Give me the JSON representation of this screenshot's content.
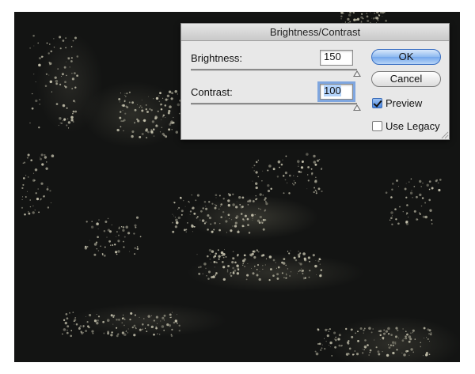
{
  "dialog": {
    "title": "Brightness/Contrast",
    "brightness": {
      "label": "Brightness:",
      "value": "150",
      "slider_level": 1.0
    },
    "contrast": {
      "label": "Contrast:",
      "value": "100",
      "slider_level": 1.0
    },
    "ok_label": "OK",
    "cancel_label": "Cancel",
    "preview": {
      "label": "Preview",
      "checked": true
    },
    "use_legacy": {
      "label": "Use Legacy",
      "checked": false
    }
  },
  "colors": {
    "canvas_background": "#131413",
    "texture_highlight": "#c8c5b0",
    "default_button": "#74a7ec"
  }
}
